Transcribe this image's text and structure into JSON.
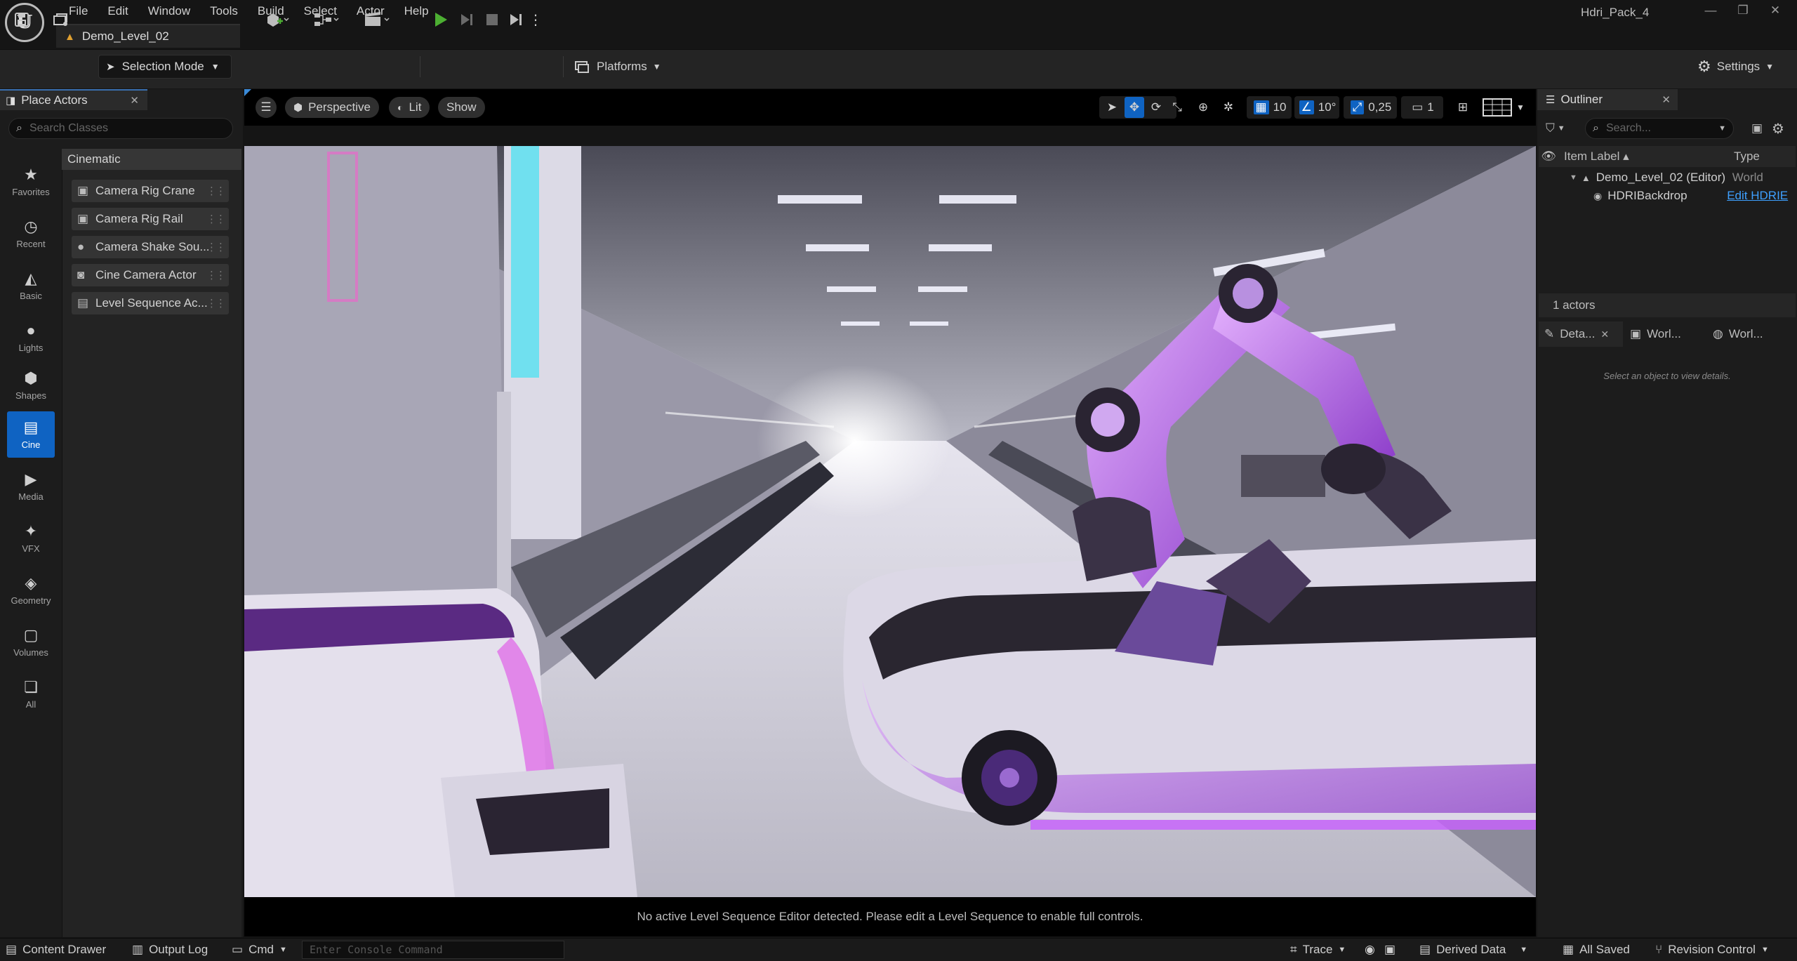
{
  "menu": [
    "File",
    "Edit",
    "Window",
    "Tools",
    "Build",
    "Select",
    "Actor",
    "Help"
  ],
  "level_tab": "Demo_Level_02",
  "project_name": "Hdri_Pack_4",
  "toolbar": {
    "selection_mode": "Selection Mode",
    "platforms": "Platforms",
    "settings": "Settings"
  },
  "place_actors": {
    "title": "Place Actors",
    "search_placeholder": "Search Classes",
    "categories": [
      "Favorites",
      "Recent",
      "Basic",
      "Lights",
      "Shapes",
      "Cine",
      "Media",
      "VFX",
      "Geometry",
      "Volumes",
      "All"
    ],
    "active_category": "Cine",
    "section": "Cinematic",
    "items": [
      "Camera Rig Crane",
      "Camera Rig Rail",
      "Camera Shake Sou...",
      "Cine Camera Actor",
      "Level Sequence Ac..."
    ]
  },
  "viewport": {
    "perspective": "Perspective",
    "lit": "Lit",
    "show": "Show",
    "grid_snap": "10",
    "rot_snap": "10°",
    "scale_snap": "0,25",
    "camera_speed": "1",
    "footer_message": "No active Level Sequence Editor detected. Please edit a Level Sequence to enable full controls."
  },
  "outliner": {
    "title": "Outliner",
    "search_placeholder": "Search...",
    "col_label": "Item Label ▴",
    "col_type": "Type",
    "rows": [
      {
        "label": "Demo_Level_02 (Editor)",
        "type": "World"
      },
      {
        "label": "HDRIBackdrop",
        "type": "Edit HDRIE"
      }
    ],
    "actor_count": "1 actors"
  },
  "details": {
    "tabs": [
      "Deta...",
      "Worl...",
      "Worl..."
    ],
    "empty_message": "Select an object to view details."
  },
  "statusbar": {
    "content_drawer": "Content Drawer",
    "output_log": "Output Log",
    "cmd": "Cmd",
    "console_placeholder": "Enter Console Command",
    "trace": "Trace",
    "derived_data": "Derived Data",
    "all_saved": "All Saved",
    "revision_control": "Revision Control"
  },
  "colors": {
    "accent": "#0f63c2",
    "play_green": "#4caf32",
    "link_blue": "#3ea0ff"
  }
}
